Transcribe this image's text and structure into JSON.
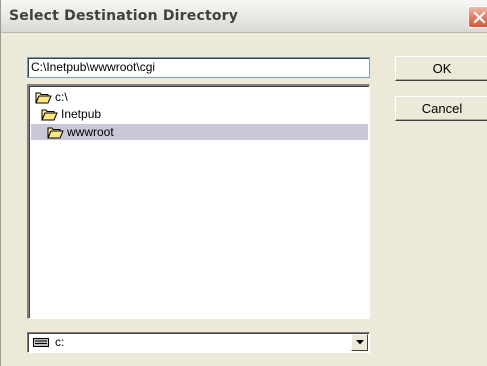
{
  "window": {
    "title": "Select Destination Directory"
  },
  "path": {
    "value": "C:\\Inetpub\\wwwroot\\cgi"
  },
  "buttons": {
    "ok_label": "OK",
    "cancel_label": "Cancel"
  },
  "directory_tree": {
    "items": [
      {
        "label": "c:\\",
        "icon": "open-folder-icon",
        "selected": false
      },
      {
        "label": "Inetpub",
        "icon": "open-folder-icon",
        "selected": false
      },
      {
        "label": "wwwroot",
        "icon": "open-folder-icon",
        "selected": true
      }
    ]
  },
  "drive": {
    "value": "c:",
    "icon": "drive-icon"
  },
  "colors": {
    "selection": "#c8c8d8",
    "dialog_background": "#ece9d8",
    "close_button": "#d4573c"
  }
}
